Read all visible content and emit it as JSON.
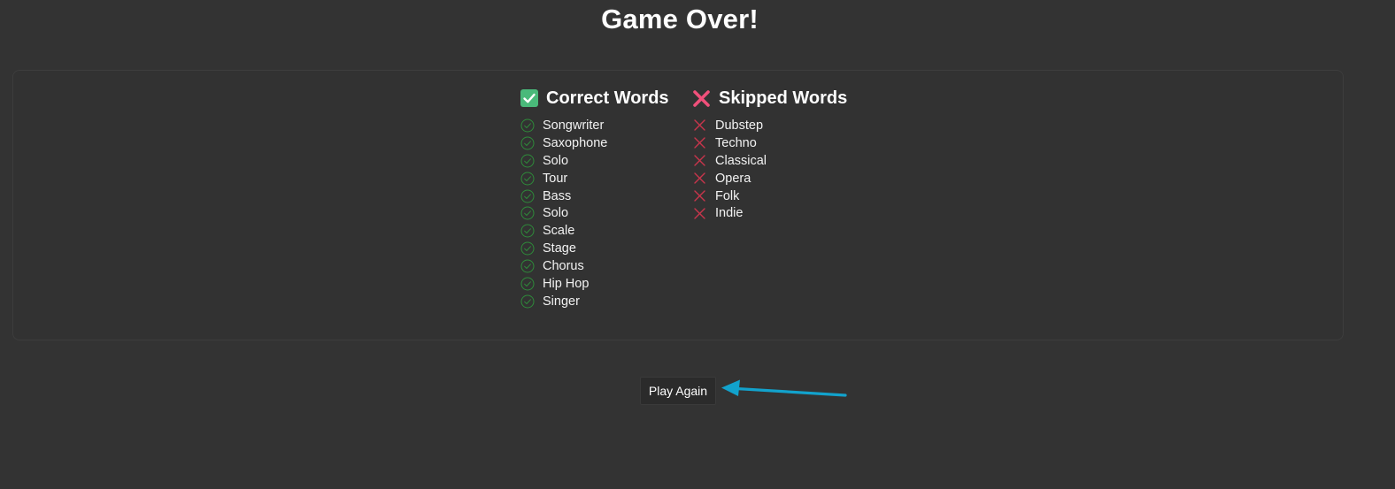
{
  "title": "Game Over!",
  "correct": {
    "header": "Correct Words",
    "header_icon": "check-box-icon",
    "item_icon": "circle-check-icon",
    "items": [
      "Songwriter",
      "Saxophone",
      "Solo",
      "Tour",
      "Bass",
      "Solo",
      "Scale",
      "Stage",
      "Chorus",
      "Hip Hop",
      "Singer"
    ]
  },
  "skipped": {
    "header": "Skipped Words",
    "header_icon": "cross-mark-icon",
    "item_icon": "x-icon",
    "items": [
      "Dubstep",
      "Techno",
      "Classical",
      "Opera",
      "Folk",
      "Indie"
    ]
  },
  "play_again_label": "Play Again",
  "annotation": "arrow-pointer-icon",
  "colors": {
    "background": "#333333",
    "correct_green": "#4ab97a",
    "correct_outline": "#2e8b3a",
    "skipped_red": "#f0507a",
    "skipped_item_red": "#c9354c",
    "arrow_blue": "#12a2cc"
  }
}
